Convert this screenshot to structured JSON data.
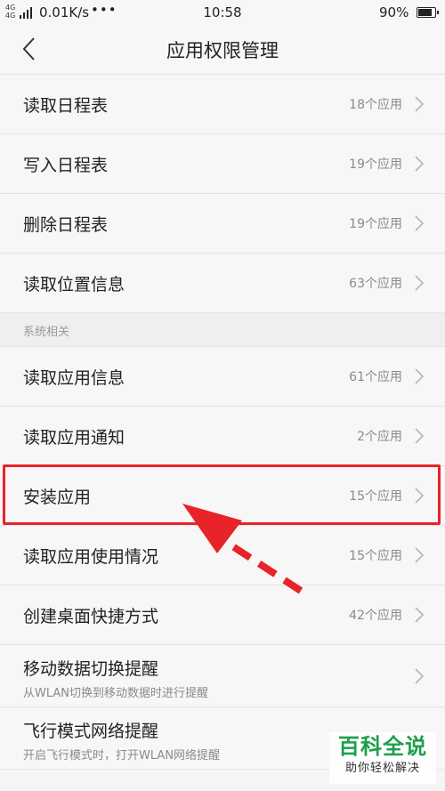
{
  "status_bar": {
    "network": "4G",
    "network2": "4G",
    "speed": "0.01K/s",
    "dots": "•••",
    "time": "10:58",
    "battery": "90%",
    "battery_level": 0.9
  },
  "header": {
    "title": "应用权限管理"
  },
  "rows": [
    {
      "label": "读取日程表",
      "count": "18个应用"
    },
    {
      "label": "写入日程表",
      "count": "19个应用"
    },
    {
      "label": "删除日程表",
      "count": "19个应用"
    },
    {
      "label": "读取位置信息",
      "count": "63个应用"
    }
  ],
  "section": {
    "title": "系统相关"
  },
  "system_rows": [
    {
      "label": "读取应用信息",
      "count": "61个应用"
    },
    {
      "label": "读取应用通知",
      "count": "2个应用"
    },
    {
      "label": "安装应用",
      "count": "15个应用"
    },
    {
      "label": "读取应用使用情况",
      "count": "15个应用"
    },
    {
      "label": "创建桌面快捷方式",
      "count": "42个应用"
    }
  ],
  "two_line_rows": [
    {
      "label": "移动数据切换提醒",
      "sub": "从WLAN切换到移动数据时进行提醒"
    },
    {
      "label": "飞行模式网络提醒",
      "sub": "开启飞行模式时，打开WLAN网络提醒"
    }
  ],
  "watermark": {
    "title": "百科全说",
    "sub": "助你轻松解决"
  },
  "colors": {
    "highlight": "#e8232a",
    "watermark_green": "#1aa04a"
  }
}
